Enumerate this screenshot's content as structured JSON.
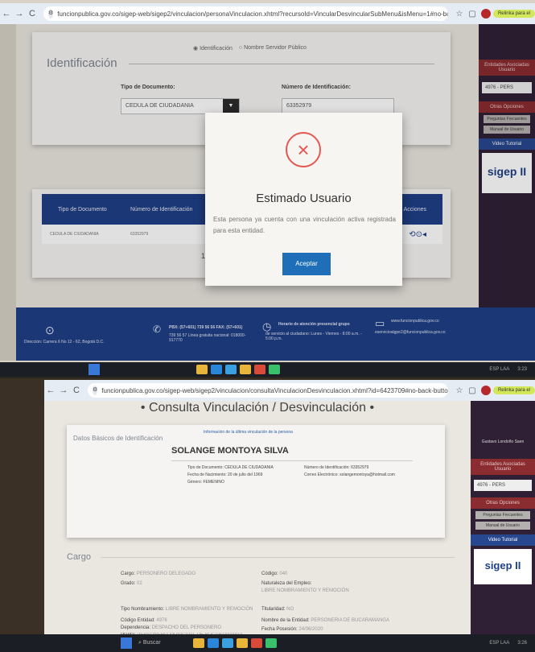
{
  "top": {
    "url": "funcionpublica.gov.co/sigep-web/sigep2/vinculacion/personaVinculacion.xhtml?recursoId=VincularDesvincularSubMenu&isMenu=1#no-back-but...",
    "profile_pill": "Relinka para el",
    "section_title": "Identificación",
    "radio_identificacion": "Identificación",
    "radio_nombre": "Nombre Servidor Público",
    "tipo_doc_label": "Tipo de Documento:",
    "tipo_doc_value": "CEDULA DE CIUDADANIA",
    "num_id_label": "Número de Identificación:",
    "num_id_value": "63352979",
    "table": {
      "headers": [
        "Tipo de Documento",
        "Número de Identificación",
        "Acciones"
      ],
      "row": [
        "CEDULA DE CIUDADANIA",
        "63352979"
      ],
      "pagination": "10"
    },
    "modal": {
      "title": "Estimado Usuario",
      "message": "Esta persona ya cuenta con una vinculación activa registrada para esta entidad.",
      "accept": "Aceptar"
    },
    "sidebar": {
      "entidades": "Entidades Asociadas Usuario",
      "entity_code": "4976 - PERS",
      "otras": "Otras Opciones",
      "preguntas": "Preguntas Frecuentes",
      "manual": "Manual de Usuario",
      "video": "Video Tutorial",
      "logo": "sigep II"
    },
    "footer": {
      "direccion": "Dirección: Carrera 6 No 12 - 62, Bogotá D.C.",
      "pbx": "PBX: (57+601) 739 56 56 FAX: (57+601)",
      "pbx2": "739 56 57 Línea gratuita nacional: 018000-917770",
      "horario": "Horario de atención presencial grupo",
      "horario2": "de servicio al ciudadano: Lunes - Viernes - 8:00 a.m. - 5:00 p.m.",
      "web": "www.funcionpublica.gov.co",
      "email": "eservicioalgpe2@funcionpublica.gov.co"
    },
    "taskbar": {
      "lang": "ESP LAA",
      "time": "3:23"
    }
  },
  "bottom": {
    "url": "funcionpublica.gov.co/sigep-web/sigep2/vinculacion/consultaVinculacionDesvinculacion.xhtml?id=6423709#no-back-button",
    "profile_pill": "Relinka para el",
    "page_title": "• Consulta Vinculación / Desvinculación •",
    "info_note": "Información de la última vinculación de la persona",
    "basic_title": "Datos Básicos de Identificación",
    "person_name": "SOLANGE MONTOYA SILVA",
    "tipo_doc": "Tipo de Documento: CEDULA DE CIUDADANIA",
    "fecha_nac": "Fecha de Nacimiento: 20 de julio del 1969",
    "genero": "Género: FEMENINO",
    "num_id": "Número de Identificación: 63352979",
    "correo": "Correo Electrónico: solangemontoya@hotmail.com",
    "cargo_title": "Cargo",
    "cargo_label": "Cargo:",
    "cargo_value": "PERSONERO DELEGADO",
    "grado_label": "Grado:",
    "grado_value": "02",
    "codigo_label": "Código:",
    "codigo_value": "040",
    "naturaleza_label": "Naturaleza del Empleo:",
    "naturaleza_value": "LIBRE NOMBRAMIENTO Y REMOCIÓN",
    "tipo_nombramiento_label": "Tipo Nombramiento:",
    "tipo_nombramiento_value": "LIBRE NOMBRAMIENTO Y REMOCIÓN",
    "titularidad_label": "Titularidad:",
    "titularidad_value": "NO",
    "codigo_entidad_label": "Código Entidad:",
    "codigo_entidad_value": "4976",
    "dependencia_label": "Dependencia:",
    "dependencia_value": "DESPACHO DEL PERSONERO",
    "planta_label": "Planta:",
    "planta_value": "PERSONERIA MUNICIPAL DE BUCARAMANGA",
    "nombre_entidad_label": "Nombre de la Entidad:",
    "nombre_entidad_value": "PERSONERIA DE BUCARAMANGA",
    "fecha_posesion_label": "Fecha Posesión:",
    "fecha_posesion_value": "24/06/2020",
    "sidebar": {
      "user": "Gustavo Londoño Saen",
      "entidades": "Entidades Asociadas Usuario",
      "entity_code": "4976 - PERS",
      "otras": "Otras Opciones",
      "preguntas": "Preguntas Frecuentes",
      "manual": "Manual de Usuario",
      "video": "Video Tutorial",
      "logo": "sigep II"
    },
    "taskbar": {
      "search": "Buscar",
      "lang": "ESP LAA",
      "time": "3:26"
    }
  }
}
